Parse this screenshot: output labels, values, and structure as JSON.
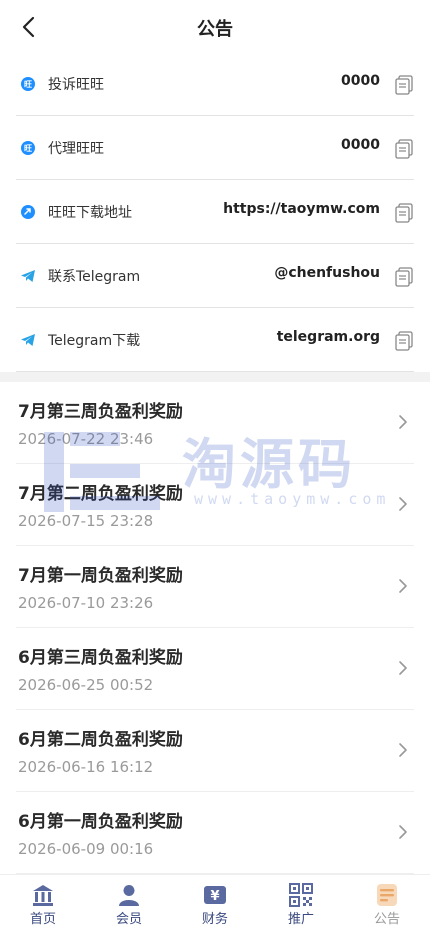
{
  "header": {
    "title": "公告"
  },
  "info_rows": [
    {
      "label": "投诉旺旺",
      "value": "0000",
      "icon": "wangwang-icon"
    },
    {
      "label": "代理旺旺",
      "value": "0000",
      "icon": "wangwang-icon"
    },
    {
      "label": "旺旺下载地址",
      "value": "https://taoymw.com",
      "icon": "download-link-icon"
    },
    {
      "label": "联系Telegram",
      "value": "@chenfushou",
      "icon": "telegram-icon"
    },
    {
      "label": "Telegram下载",
      "value": "telegram.org",
      "icon": "telegram-icon"
    }
  ],
  "notices": [
    {
      "title": "7月第三周负盈利奖励",
      "time": "2026-07-22 23:46"
    },
    {
      "title": "7月第二周负盈利奖励",
      "time": "2026-07-15 23:28"
    },
    {
      "title": "7月第一周负盈利奖励",
      "time": "2026-07-10 23:26"
    },
    {
      "title": "6月第三周负盈利奖励",
      "time": "2026-06-25 00:52"
    },
    {
      "title": "6月第二周负盈利奖励",
      "time": "2026-06-16 16:12"
    },
    {
      "title": "6月第一周负盈利奖励",
      "time": "2026-06-09 00:16"
    }
  ],
  "watermark": {
    "text": "淘源码",
    "url": "www.taoymw.com"
  },
  "tabbar": {
    "items": [
      {
        "label": "首页",
        "icon": "home-bank-icon"
      },
      {
        "label": "会员",
        "icon": "member-person-icon"
      },
      {
        "label": "财务",
        "icon": "finance-yen-icon"
      },
      {
        "label": "推广",
        "icon": "qrcode-icon"
      },
      {
        "label": "公告",
        "icon": "notice-doc-icon",
        "active": true
      }
    ]
  },
  "colors": {
    "wangwang_blue": "#1e8fff",
    "telegram_blue": "#29a3e6",
    "tab_icon": "#5a6aa0",
    "active_tab_icon": "#e9a86a",
    "watermark": "#2f56c4"
  }
}
